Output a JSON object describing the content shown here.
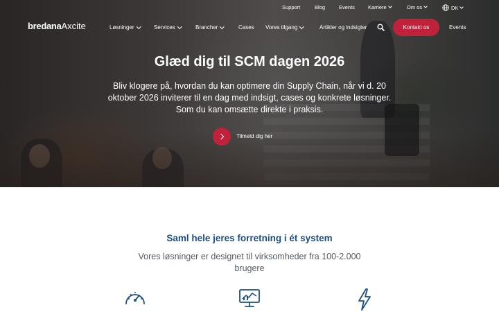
{
  "colors": {
    "accent": "#c0213b",
    "heading": "#1b4f86",
    "icon": "#1b4f86"
  },
  "utility_nav": {
    "support": "Support",
    "blog": "Blog",
    "events": "Events",
    "karriere": "Karriere",
    "om_os": "Om os",
    "language": "DK"
  },
  "brand": {
    "name_bold": "bredana",
    "name_light": "Axcite"
  },
  "main_nav": {
    "losninger": "Løsninger",
    "services": "Services",
    "brancher": "Brancher",
    "cases": "Cases",
    "vores_tilgang": "Vores tilgang",
    "artikler": "Artikler og indsigter",
    "contact": "Kontakt os",
    "events": "Events"
  },
  "hero": {
    "title": "Glæd dig til SCM dagen 2026",
    "subtitle": "Bliv klogere på, hvordan du kan optimere din Supply Chain, når vi d. 20 oktober 2026 inviterer til en dag med indsigt, cases og konkrete løsninger. Som du kan omsætte direkte i praksis.",
    "cta_label": "Tilmeld dig her"
  },
  "section": {
    "title": "Saml hele jeres forretning i ét system",
    "subtitle": "Vores løsninger er designet til virksomheder fra 100-2.000 brugere"
  },
  "icons": [
    "speedometer-icon",
    "monitor-chart-icon",
    "lightning-icon"
  ]
}
